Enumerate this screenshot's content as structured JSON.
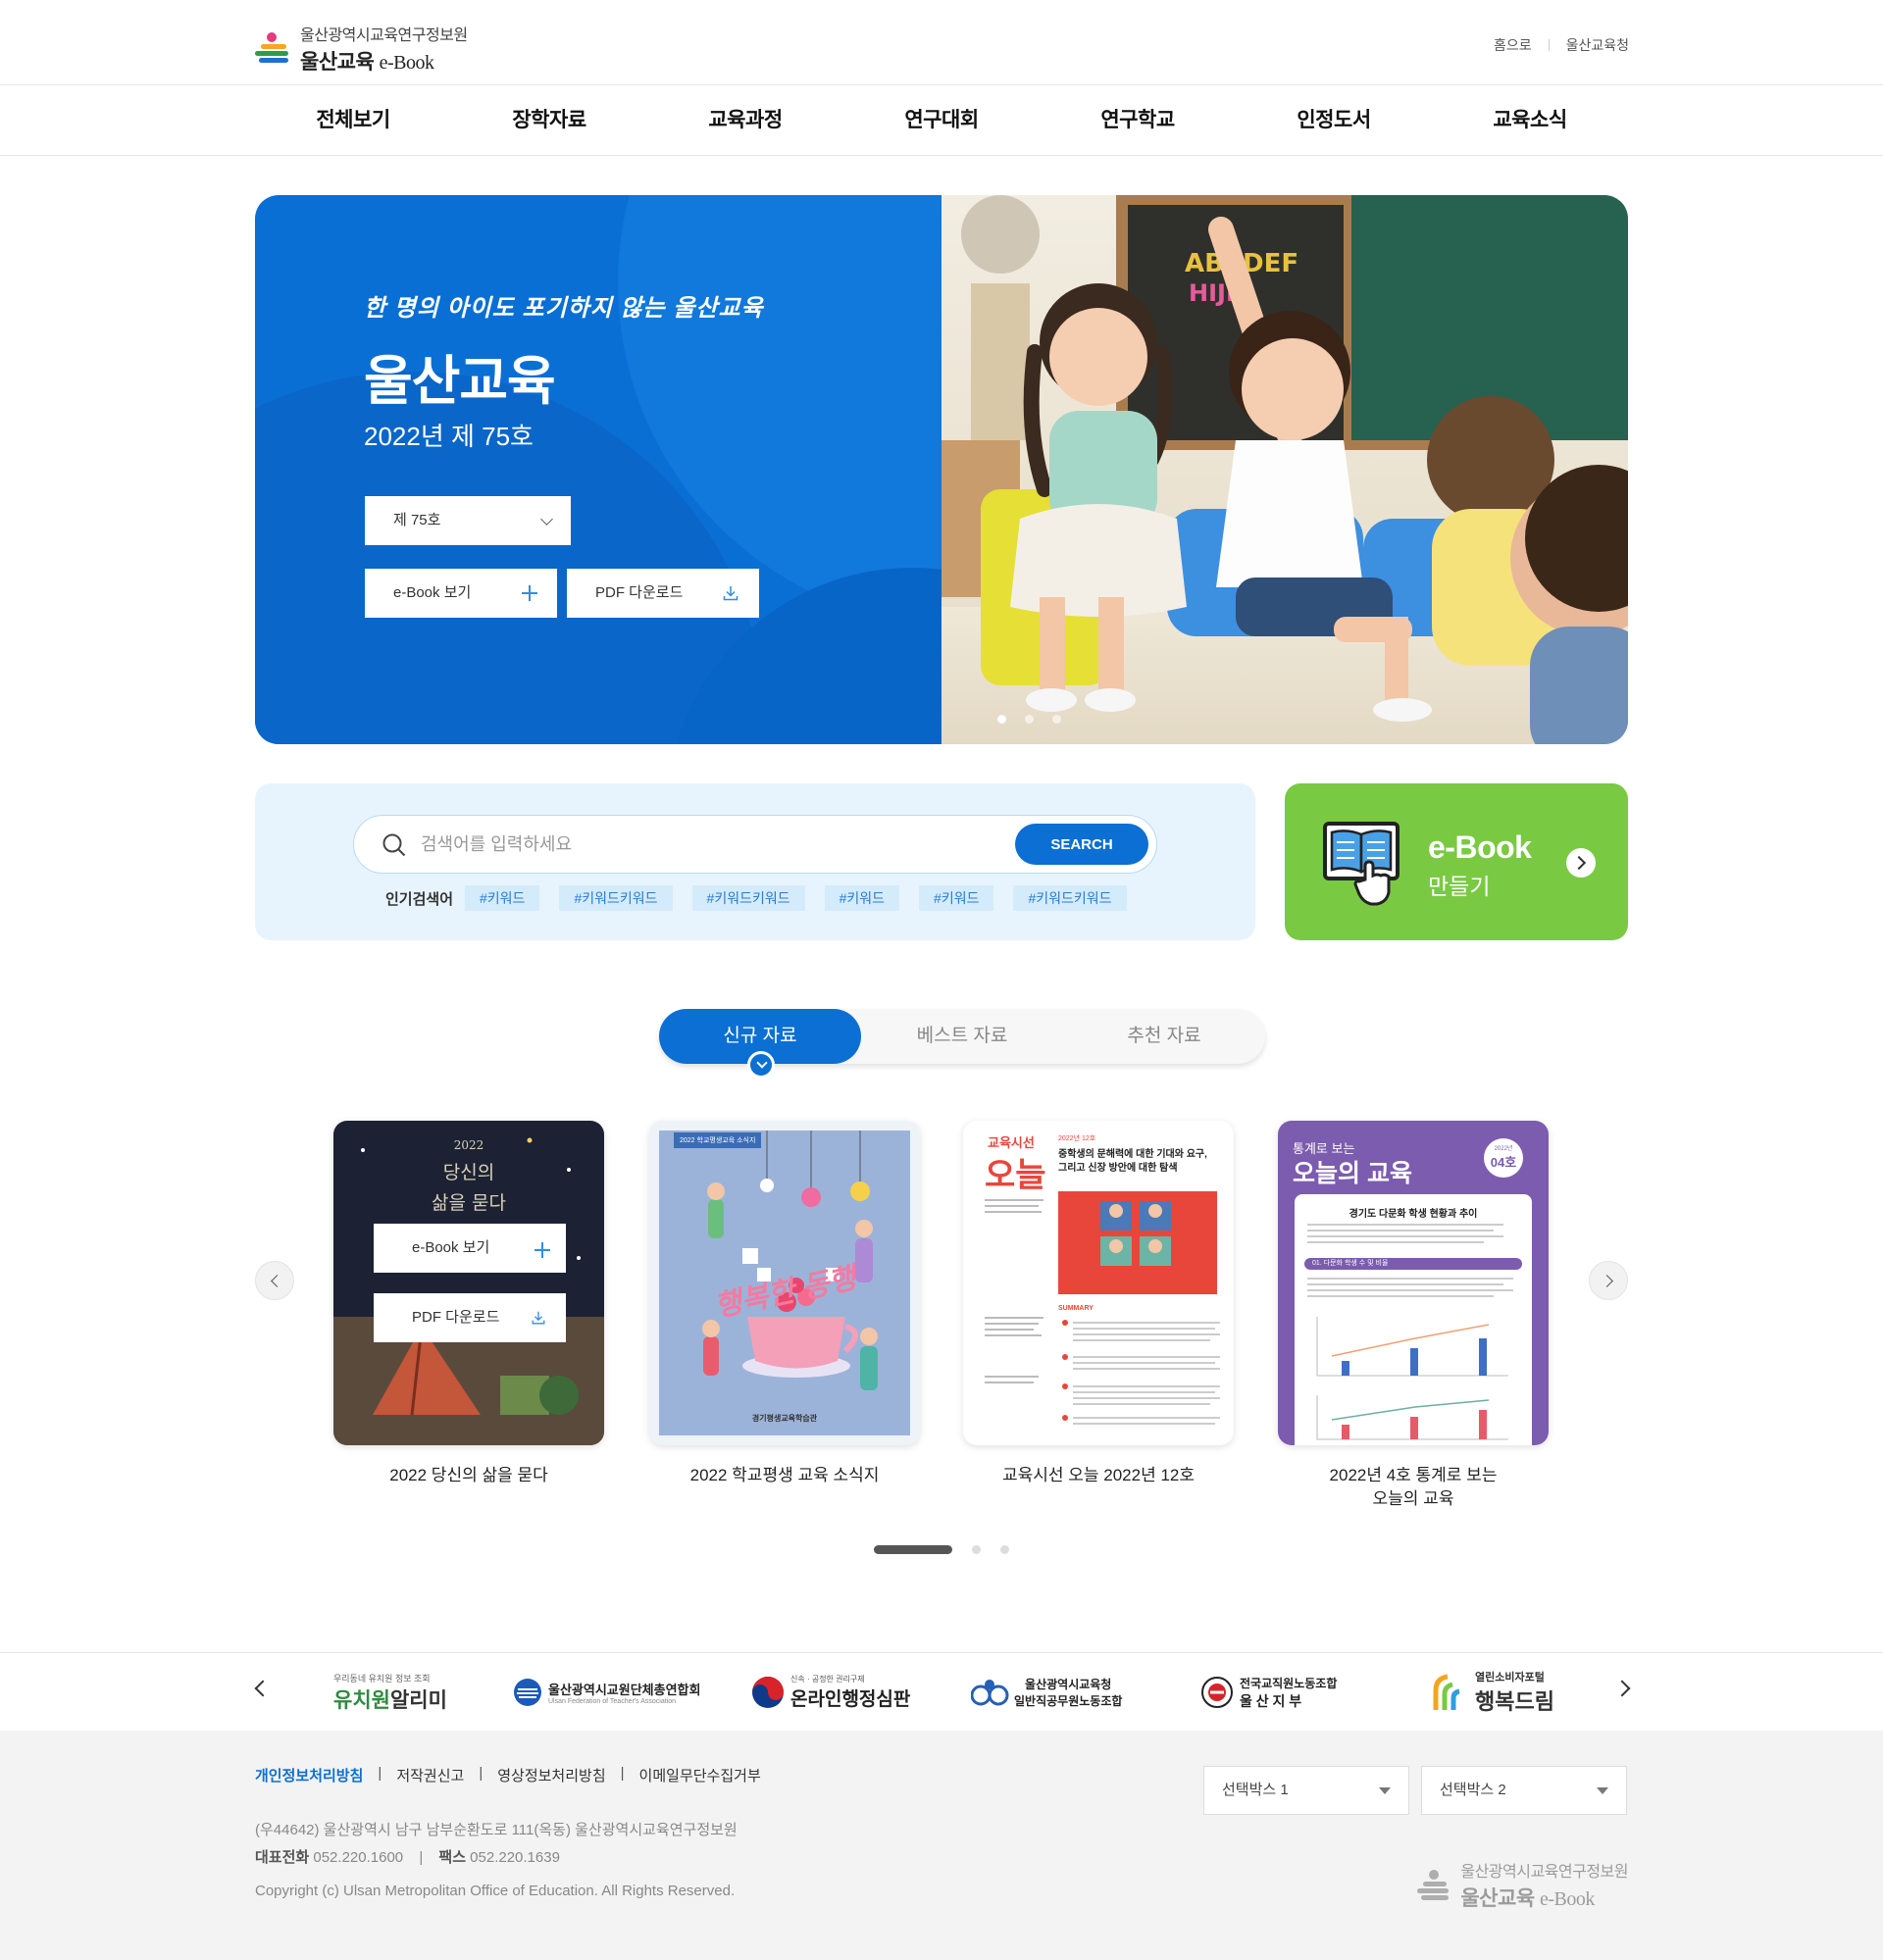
{
  "header": {
    "logo_line1": "울산광역시교육연구정보원",
    "logo_line2_ko": "울산교육",
    "logo_line2_en": "e-Book",
    "util_links": [
      "홈으로",
      "울산교육청"
    ]
  },
  "gnb": [
    "전체보기",
    "장학자료",
    "교육과정",
    "연구대회",
    "연구학교",
    "인정도서",
    "교육소식"
  ],
  "hero": {
    "slogan": "한 명의 아이도 포기하지 않는 울산교육",
    "title": "울산교육",
    "subtitle": "2022년 제 75호",
    "issue_select": "제 75호",
    "ebook_btn": "e-Book 보기",
    "pdf_btn": "PDF 다운로드",
    "slide_count": 3,
    "active_slide": 1,
    "chalkboard_text": "ABCDEF HIJK"
  },
  "search": {
    "placeholder": "검색어를 입력하세요",
    "button": "SEARCH",
    "popular_label": "인기검색어",
    "keywords": [
      "#키워드",
      "#키워드키워드",
      "#키워드키워드",
      "#키워드",
      "#키워드",
      "#키워드키워드"
    ]
  },
  "ebook_make": {
    "line1": "e-Book",
    "line2": "만들기"
  },
  "tabs": [
    "신규 자료",
    "베스트 자료",
    "추천 자료"
  ],
  "active_tab": 0,
  "books": [
    {
      "title": "2022 당신의 삶을 묻다",
      "cover_text": [
        "2022",
        "당신의",
        "삶을 묻다"
      ],
      "ebook_btn": "e-Book 보기",
      "pdf_btn": "PDF 다운로드"
    },
    {
      "title": "2022 학교평생 교육 소식지",
      "cover_badge": "2022 학교평생교육 소식지",
      "cover_text": "행복한 동행",
      "cover_footer": "경기평생교육학습관"
    },
    {
      "title": "교육시선 오늘 2022년 12호",
      "cover_kicker": "교육시선",
      "cover_big": "오늘",
      "cover_issue": "2022년 12호",
      "cover_head": "중학생의 문해력에 대한 기대와 요구, 그리고 신장 방안에 대한 탐색",
      "cover_summary": "SUMMARY"
    },
    {
      "title_line1": "2022년 4호 통계로 보는",
      "title_line2": "오늘의 교육",
      "cover_kicker": "통계로 보는",
      "cover_big": "오늘의 교육",
      "cover_badge_year": "2022년",
      "cover_badge_no": "04호",
      "cover_section": "경기도 다문화 학생 현황과 추이",
      "cover_sub": "01. 다문화 학생 수 및 비율"
    }
  ],
  "pager": {
    "count": 3,
    "active": 0
  },
  "banners": [
    {
      "small": "우리동네 유치원 정보 조회",
      "big1": "유치원",
      "big2": "알리미"
    },
    {
      "big": "울산광역시교원단체총연합회",
      "small": "Ulsan Federation of Teacher's Association"
    },
    {
      "small": "신속 · 공정한 권리구제",
      "big": "온라인행정심판"
    },
    {
      "big1": "울산광역시교육청",
      "big2": "일반직공무원노동조합"
    },
    {
      "big1": "전국교직원노동조합",
      "big2": "울 산 지 부"
    },
    {
      "small": "열린소비자포털",
      "big": "행복드림"
    }
  ],
  "footer": {
    "links": [
      "개인정보처리방침",
      "저작권신고",
      "영상정보처리방침",
      "이메일무단수집거부"
    ],
    "address": "(우44642) 울산광역시 남구 남부순환도로 111(옥동) 울산광역시교육연구정보원",
    "tel_label": "대표전화",
    "tel": "052.220.1600",
    "fax_label": "팩스",
    "fax": "052.220.1639",
    "copyright": "Copyright (c) Ulsan Metropolitan Office of Education. All Rights Reserved.",
    "select1": "선택박스 1",
    "select2": "선택박스 2",
    "logo_line1": "울산광역시교육연구정보원",
    "logo_line2_ko": "울산교육",
    "logo_line2_en": "e-Book"
  },
  "colors": {
    "primary": "#0b6fd3",
    "green": "#7ac943",
    "light_blue_bg": "#e8f4fd"
  }
}
